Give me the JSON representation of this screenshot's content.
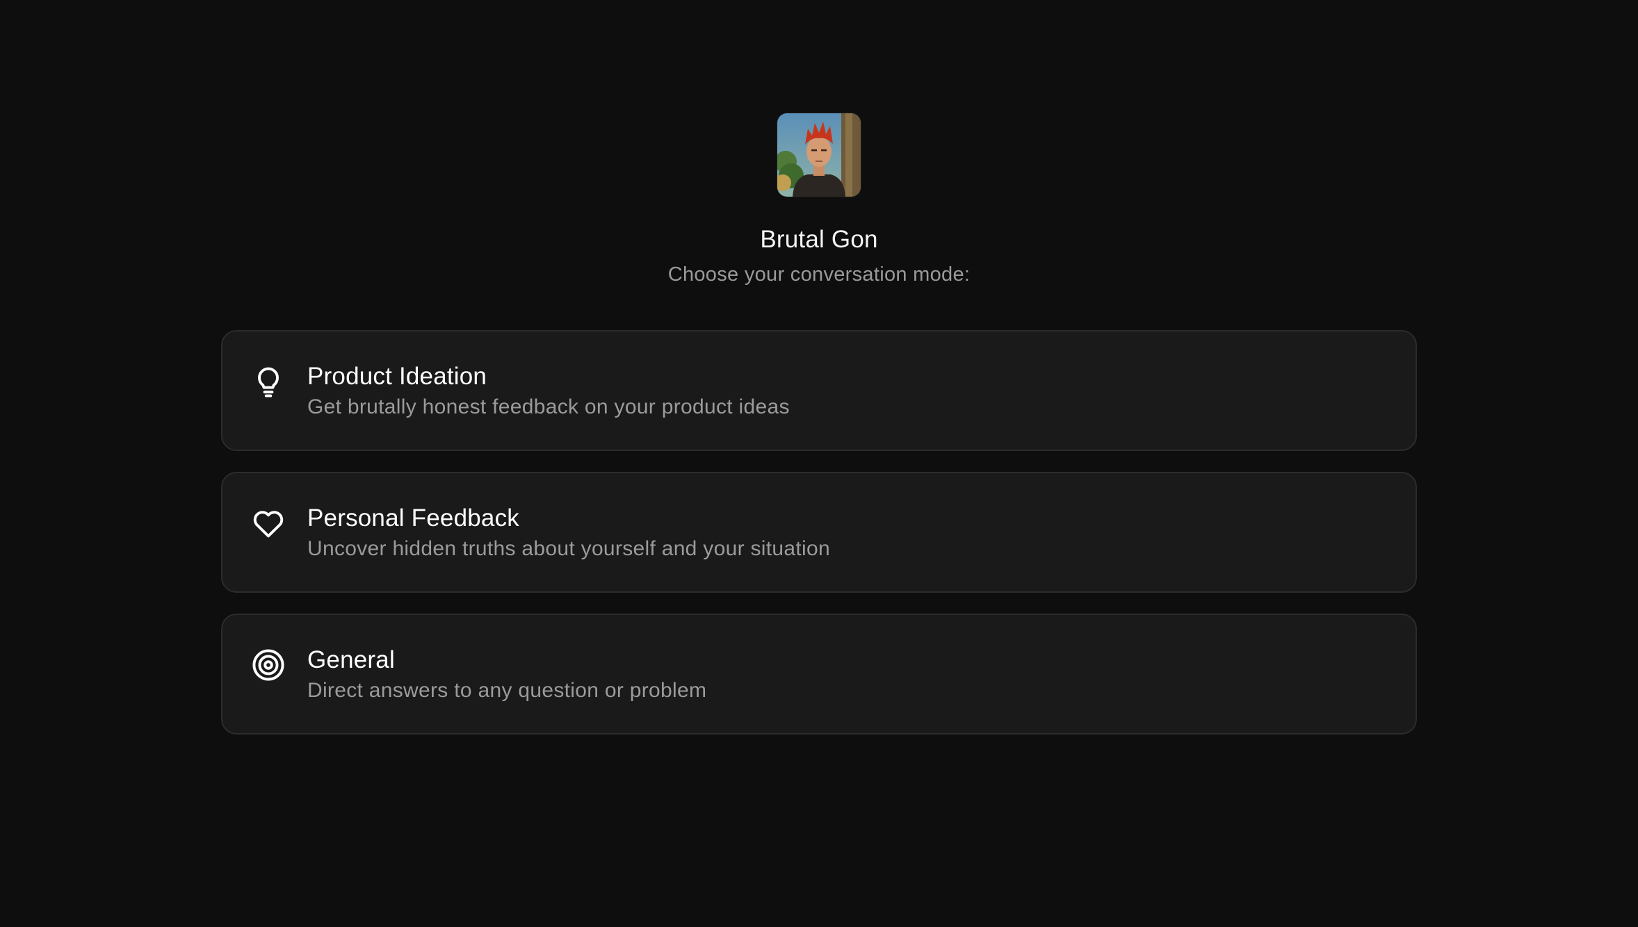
{
  "header": {
    "avatar_icon": "avatar-portrait-red-hair",
    "bot_name": "Brutal Gon",
    "subtitle": "Choose your conversation mode:"
  },
  "modes": [
    {
      "icon": "lightbulb-icon",
      "title": "Product Ideation",
      "description": "Get brutally honest feedback on your product ideas"
    },
    {
      "icon": "heart-icon",
      "title": "Personal Feedback",
      "description": "Uncover hidden truths about yourself and your situation"
    },
    {
      "icon": "target-icon",
      "title": "General",
      "description": "Direct answers to any question or problem"
    }
  ],
  "colors": {
    "background": "#0e0e0e",
    "card_background": "#1a1a1b",
    "card_border": "#2c2c2e",
    "title_text": "#ffffff",
    "muted_text": "#9b9b9b"
  }
}
